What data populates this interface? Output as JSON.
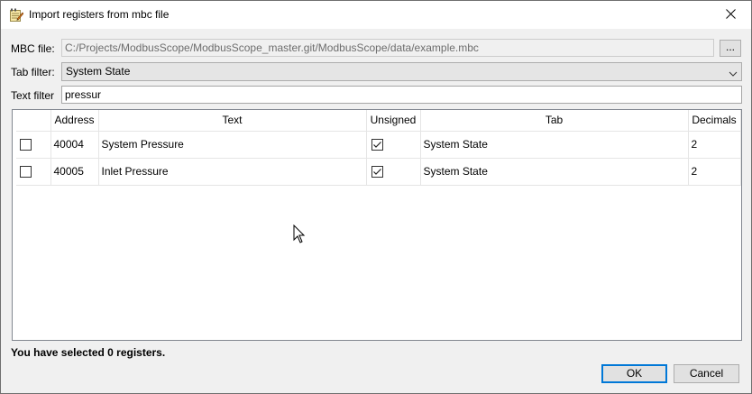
{
  "window": {
    "title": "Import registers from mbc file",
    "title_icon": "notepad-edit-icon",
    "close_icon": "close-icon"
  },
  "form": {
    "mbc_file_label": "MBC file:",
    "mbc_file_value": "C:/Projects/ModbusScope/ModbusScope_master.git/ModbusScope/data/example.mbc",
    "browse_label": "...",
    "tab_filter_label": "Tab filter:",
    "tab_filter_value": "System State",
    "text_filter_label": "Text filter",
    "text_filter_value": "pressur"
  },
  "table": {
    "headers": [
      "",
      "Address",
      "Text",
      "Unsigned",
      "Tab",
      "Decimals"
    ],
    "rows": [
      {
        "selected": false,
        "address": "40004",
        "text": "System Pressure",
        "unsigned": true,
        "tab": "System State",
        "decimals": "2"
      },
      {
        "selected": false,
        "address": "40005",
        "text": "Inlet Pressure",
        "unsigned": true,
        "tab": "System State",
        "decimals": "2"
      }
    ]
  },
  "status": "You have selected 0 registers.",
  "buttons": {
    "ok": "OK",
    "cancel": "Cancel"
  },
  "colors": {
    "accent": "#0078d7",
    "titlebar": "#ffffff",
    "window_bg": "#f0f0f0"
  }
}
